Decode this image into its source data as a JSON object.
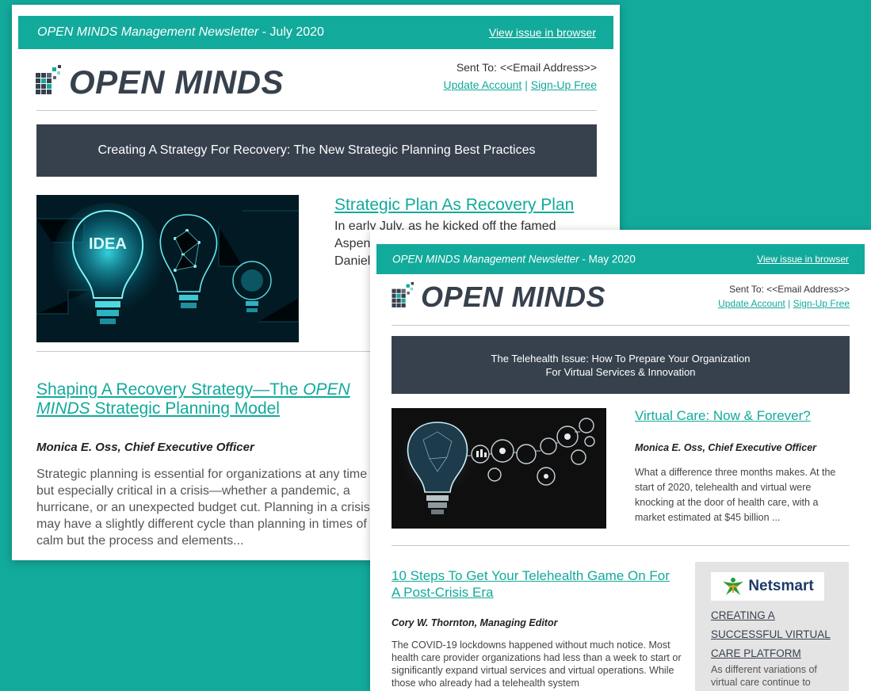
{
  "newsletter_july": {
    "brand": "OPEN MINDS",
    "title_brand": "OPEN MINDS Management Newsletter",
    "title_issue": " - July 2020",
    "view_link": "View issue in browser",
    "sent_to": "Sent To: <<Email Address>>",
    "update_account": "Update Account",
    "separator": " | ",
    "sign_up": "Sign-Up Free",
    "banner": "Creating A Strategy For Recovery: The New Strategic Planning Best Practices",
    "article1": {
      "title": "Strategic Plan As Recovery Plan",
      "lead": "In early July, as he kicked off the famed Aspen                 —Asp                Daniel               are at               COVID"
    },
    "article2": {
      "title_part1": "Shaping A Recovery Strategy—The ",
      "title_italic": "OPEN MINDS",
      "title_part2": " Strategic Planning Model",
      "author": "Monica E. Oss, Chief Executive Officer",
      "body": "Strategic planning is essential for organizations at any time but especially critical in a crisis—whether a pandemic, a hurricane, or an unexpected budget cut. Planning in a crisis may have a slightly different cycle than planning in times of calm but the process and elements..."
    },
    "image_text": "IDEA"
  },
  "newsletter_may": {
    "brand": "OPEN MINDS",
    "title_brand": "OPEN MINDS Management Newsletter",
    "title_issue": " - May 2020",
    "view_link": "View issue in browser",
    "sent_to": "Sent To: <<Email Address>>",
    "update_account": "Update Account",
    "separator": " | ",
    "sign_up": "Sign-Up Free",
    "banner_line1": "The Telehealth Issue: How To Prepare Your Organization",
    "banner_line2": "For Virtual Services & Innovation",
    "article1": {
      "title": "Virtual Care: Now & Forever?",
      "author": "Monica E. Oss, Chief Executive Officer",
      "body": "What a difference three months makes. At the start of 2020, telehealth and virtual were knocking at the door of health care, with a market estimated at $45 billion ..."
    },
    "article2": {
      "title": "10 Steps To Get Your Telehealth Game On For A Post-Crisis Era",
      "author": "Cory W. Thornton, Managing Editor",
      "body": "The COVID-19 lockdowns happened without much notice. Most health care provider organizations had less than a week to start or significantly expand virtual services and virtual operations. While those who already had a telehealth system"
    },
    "sponsor": {
      "name": "Netsmart",
      "title": "CREATING A SUCCESSFUL VIRTUAL CARE PLATFORM",
      "body": "As different variations of virtual care continue to"
    }
  },
  "colors": {
    "background": "#12aa9b",
    "banner": "#37414e",
    "link": "#12aa9b"
  }
}
